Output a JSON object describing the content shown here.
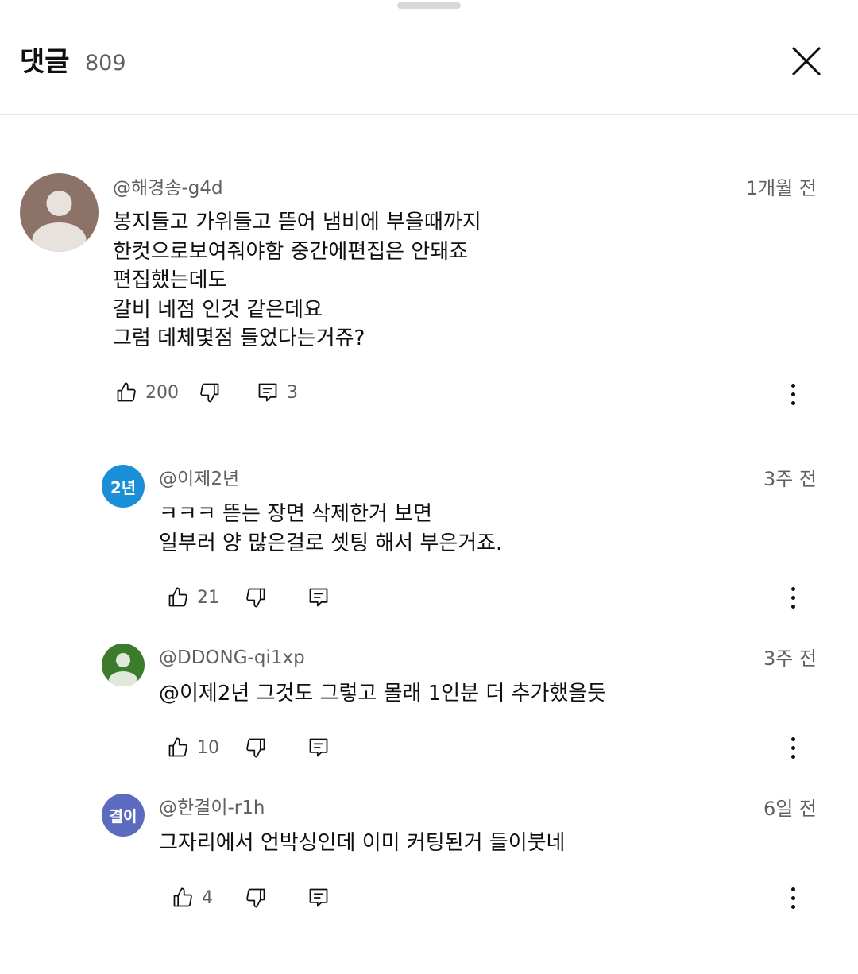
{
  "header": {
    "title": "댓글",
    "count": "809"
  },
  "comments": [
    {
      "author": "@해경송-g4d",
      "time": "1개월 전",
      "lines": [
        "봉지들고 가위들고 뜯어  냄비에 부을때까지",
        "한컷으로보여줘야함  중간에편집은 안돼죠",
        "편집했는데도",
        "갈비 네점 인것 같은데요",
        "그럼 데체몇점 들었다는거쥬?"
      ],
      "likes": "200",
      "replies": "3",
      "avatar": {
        "type": "default",
        "bg": "#8d7267"
      }
    },
    {
      "author": "@이제2년",
      "time": "3주 전",
      "lines": [
        "ㅋㅋㅋ 뜯는 장면 삭제한거 보면",
        "일부러 양 많은걸로 셋팅 해서 부은거죠."
      ],
      "likes": "21",
      "avatar": {
        "type": "text",
        "text": "2년",
        "bg": "#1a8fd8"
      }
    },
    {
      "author": "@DDONG-qi1xp",
      "time": "3주 전",
      "lines": [
        "@이제2년 그것도 그렇고 몰래 1인분 더 추가했을듯"
      ],
      "likes": "10",
      "avatar": {
        "type": "default",
        "bg": "#3c7a2c"
      }
    },
    {
      "author": "@한결이-r1h",
      "time": "6일 전",
      "lines": [
        "그자리에서 언박싱인데 이미 커팅된거 들이붓네"
      ],
      "likes": "4",
      "avatar": {
        "type": "text",
        "text": "결이",
        "bg": "#5c6bc0"
      }
    }
  ],
  "icons": {
    "close": "close-icon",
    "like": "thumb-up-icon",
    "dislike": "thumb-down-icon",
    "reply": "reply-icon",
    "more": "more-vertical-icon"
  }
}
